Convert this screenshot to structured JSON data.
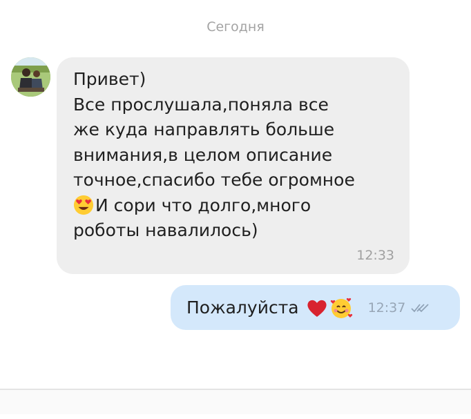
{
  "chat": {
    "date_separator": "Сегодня",
    "incoming": {
      "lines": [
        "Привет)",
        "Все прослушала,поняла все",
        "же куда направлять больше",
        "внимания,в целом описание",
        "точное,спасибо тебе огромное",
        "И сори что долго,много",
        "роботы навалилось)"
      ],
      "line6_emoji": "heart-eyes-emoji",
      "time": "12:33"
    },
    "outgoing": {
      "text": "Пожалуйста",
      "emojis": [
        "red-heart-emoji",
        "smiling-face-with-hearts-emoji"
      ],
      "time": "12:37",
      "status_icon": "double-check-icon"
    }
  },
  "composer": {
    "placeholder": ""
  },
  "colors": {
    "incoming_bubble": "#eeeeee",
    "outgoing_bubble": "#d4e8fb",
    "timestamp": "#a0a0a0"
  }
}
